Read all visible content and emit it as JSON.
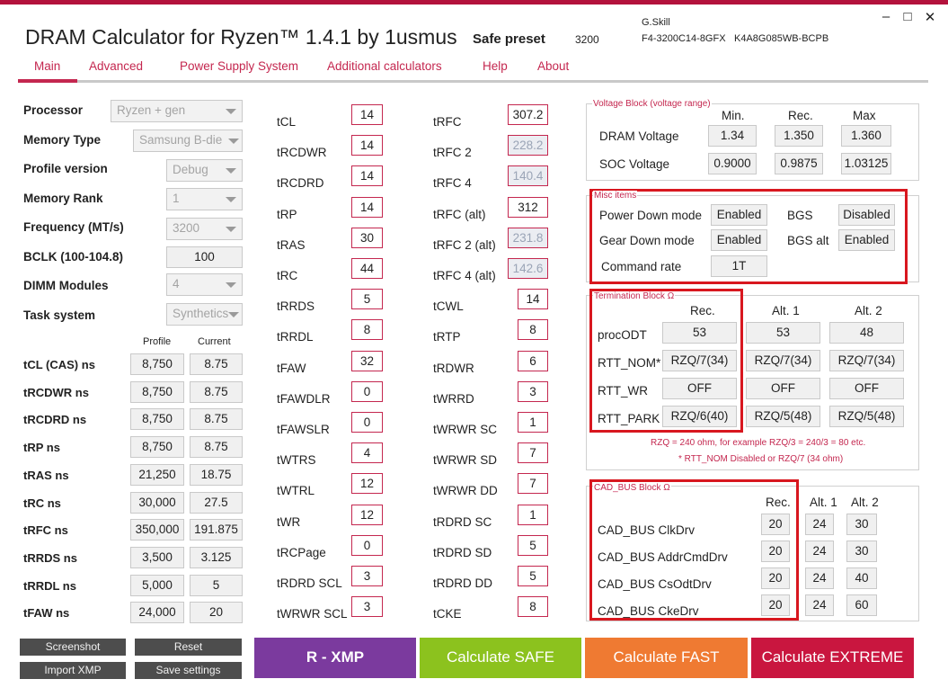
{
  "window": {
    "title": "DRAM Calculator for Ryzen™ 1.4.1 by 1usmus",
    "preset_label": "Safe preset",
    "preset_value": "3200",
    "brand": "G.Skill",
    "model": "F4-3200C14-8GFX",
    "chip": "K4A8G085WB-BCPB",
    "minimize": "–",
    "maximize": "□",
    "close": "✕"
  },
  "tabs": [
    "Main",
    "Advanced",
    "Power Supply System",
    "Additional calculators",
    "Help",
    "About"
  ],
  "settings": {
    "processor": {
      "label": "Processor",
      "value": "Ryzen + gen"
    },
    "memory_type": {
      "label": "Memory Type",
      "value": "Samsung B-die"
    },
    "profile_version": {
      "label": "Profile version",
      "value": "Debug"
    },
    "memory_rank": {
      "label": "Memory Rank",
      "value": "1"
    },
    "frequency": {
      "label": "Frequency (MT/s)",
      "value": "3200"
    },
    "bclk": {
      "label": "BCLK (100-104.8)",
      "value": "100"
    },
    "dimm_modules": {
      "label": "DIMM Modules",
      "value": "4"
    },
    "task_system": {
      "label": "Task system",
      "value": "Synthetics"
    }
  },
  "ns_table": {
    "header_profile": "Profile",
    "header_current": "Current",
    "rows": [
      {
        "label": "tCL (CAS) ns",
        "profile": "8,750",
        "current": "8.75"
      },
      {
        "label": "tRCDWR ns",
        "profile": "8,750",
        "current": "8.75"
      },
      {
        "label": "tRCDRD ns",
        "profile": "8,750",
        "current": "8.75"
      },
      {
        "label": "tRP ns",
        "profile": "8,750",
        "current": "8.75"
      },
      {
        "label": "tRAS ns",
        "profile": "21,250",
        "current": "18.75"
      },
      {
        "label": "tRC ns",
        "profile": "30,000",
        "current": "27.5"
      },
      {
        "label": "tRFC ns",
        "profile": "350,000",
        "current": "191.875"
      },
      {
        "label": "tRRDS ns",
        "profile": "3,500",
        "current": "3.125"
      },
      {
        "label": "tRRDL ns",
        "profile": "5,000",
        "current": "5"
      },
      {
        "label": "tFAW ns",
        "profile": "24,000",
        "current": "20"
      }
    ]
  },
  "timings_col1": [
    {
      "label": "tCL",
      "value": "14"
    },
    {
      "label": "tRCDWR",
      "value": "14"
    },
    {
      "label": "tRCDRD",
      "value": "14"
    },
    {
      "label": "tRP",
      "value": "14"
    },
    {
      "label": "tRAS",
      "value": "30"
    },
    {
      "label": "tRC",
      "value": "44"
    },
    {
      "label": "tRRDS",
      "value": "5"
    },
    {
      "label": "tRRDL",
      "value": "8"
    },
    {
      "label": "tFAW",
      "value": "32"
    },
    {
      "label": "tFAWDLR",
      "value": "0"
    },
    {
      "label": "tFAWSLR",
      "value": "0"
    },
    {
      "label": "tWTRS",
      "value": "4"
    },
    {
      "label": "tWTRL",
      "value": "12"
    },
    {
      "label": "tWR",
      "value": "12"
    },
    {
      "label": "tRCPage",
      "value": "0"
    },
    {
      "label": "tRDRD SCL",
      "value": "3"
    },
    {
      "label": "tWRWR SCL",
      "value": "3"
    }
  ],
  "timings_col2": [
    {
      "label": "tRFC",
      "value": "307.2",
      "disabled": false
    },
    {
      "label": "tRFC 2",
      "value": "228.2",
      "disabled": true
    },
    {
      "label": "tRFC 4",
      "value": "140.4",
      "disabled": true
    },
    {
      "label": "tRFC (alt)",
      "value": "312",
      "disabled": false
    },
    {
      "label": "tRFC 2 (alt)",
      "value": "231.8",
      "disabled": true
    },
    {
      "label": "tRFC 4 (alt)",
      "value": "142.6",
      "disabled": true
    },
    {
      "label": "tCWL",
      "value": "14",
      "disabled": false
    },
    {
      "label": "tRTP",
      "value": "8",
      "disabled": false
    },
    {
      "label": "tRDWR",
      "value": "6",
      "disabled": false
    },
    {
      "label": "tWRRD",
      "value": "3",
      "disabled": false
    },
    {
      "label": "tWRWR SC",
      "value": "1",
      "disabled": false
    },
    {
      "label": "tWRWR SD",
      "value": "7",
      "disabled": false
    },
    {
      "label": "tWRWR DD",
      "value": "7",
      "disabled": false
    },
    {
      "label": "tRDRD SC",
      "value": "1",
      "disabled": false
    },
    {
      "label": "tRDRD SD",
      "value": "5",
      "disabled": false
    },
    {
      "label": "tRDRD DD",
      "value": "5",
      "disabled": false
    },
    {
      "label": "tCKE",
      "value": "8",
      "disabled": false
    }
  ],
  "voltage": {
    "title": "Voltage Block (voltage range)",
    "h_min": "Min.",
    "h_rec": "Rec.",
    "h_max": "Max",
    "rows": [
      {
        "label": "DRAM Voltage",
        "min": "1.34",
        "rec": "1.350",
        "max": "1.360"
      },
      {
        "label": "SOC Voltage",
        "min": "0.9000",
        "rec": "0.9875",
        "max": "1.03125"
      }
    ]
  },
  "misc": {
    "title": "Misc items",
    "power_down_label": "Power Down mode",
    "power_down": "Enabled",
    "bgs_label": "BGS",
    "bgs": "Disabled",
    "gear_down_label": "Gear Down mode",
    "gear_down": "Enabled",
    "bgs_alt_label": "BGS alt",
    "bgs_alt": "Enabled",
    "command_rate_label": "Command rate",
    "command_rate": "1T"
  },
  "termination": {
    "title": "Termination Block Ω",
    "h_rec": "Rec.",
    "h_alt1": "Alt. 1",
    "h_alt2": "Alt. 2",
    "rows": [
      {
        "label": "procODT",
        "rec": "53",
        "alt1": "53",
        "alt2": "48"
      },
      {
        "label": "RTT_NOM*",
        "rec": "RZQ/7(34)",
        "alt1": "RZQ/7(34)",
        "alt2": "RZQ/7(34)"
      },
      {
        "label": "RTT_WR",
        "rec": "OFF",
        "alt1": "OFF",
        "alt2": "OFF"
      },
      {
        "label": "RTT_PARK",
        "rec": "RZQ/6(40)",
        "alt1": "RZQ/5(48)",
        "alt2": "RZQ/5(48)"
      }
    ],
    "note1": "RZQ = 240 ohm, for example RZQ/3 = 240/3 = 80 etc.",
    "note2": "* RTT_NOM Disabled or RZQ/7 (34 ohm)"
  },
  "cadbus": {
    "title": "CAD_BUS Block Ω",
    "h_rec": "Rec.",
    "h_alt1": "Alt. 1",
    "h_alt2": "Alt. 2",
    "rows": [
      {
        "label": "CAD_BUS ClkDrv",
        "rec": "20",
        "alt1": "24",
        "alt2": "30"
      },
      {
        "label": "CAD_BUS AddrCmdDrv",
        "rec": "20",
        "alt1": "24",
        "alt2": "30"
      },
      {
        "label": "CAD_BUS CsOdtDrv",
        "rec": "20",
        "alt1": "24",
        "alt2": "40"
      },
      {
        "label": "CAD_BUS CkeDrv",
        "rec": "20",
        "alt1": "24",
        "alt2": "60"
      }
    ]
  },
  "buttons": {
    "screenshot": "Screenshot",
    "reset": "Reset",
    "import_xmp": "Import XMP",
    "save_settings": "Save settings",
    "rxmp": "R - XMP",
    "calc_safe": "Calculate SAFE",
    "calc_fast": "Calculate FAST",
    "calc_extreme": "Calculate EXTREME"
  },
  "colors": {
    "accent": "#c4274f",
    "rxmp": "#7b3a9e",
    "safe": "#8cc21e",
    "fast": "#ef7a32",
    "extreme": "#c9163f",
    "highlight": "#d8171f"
  }
}
